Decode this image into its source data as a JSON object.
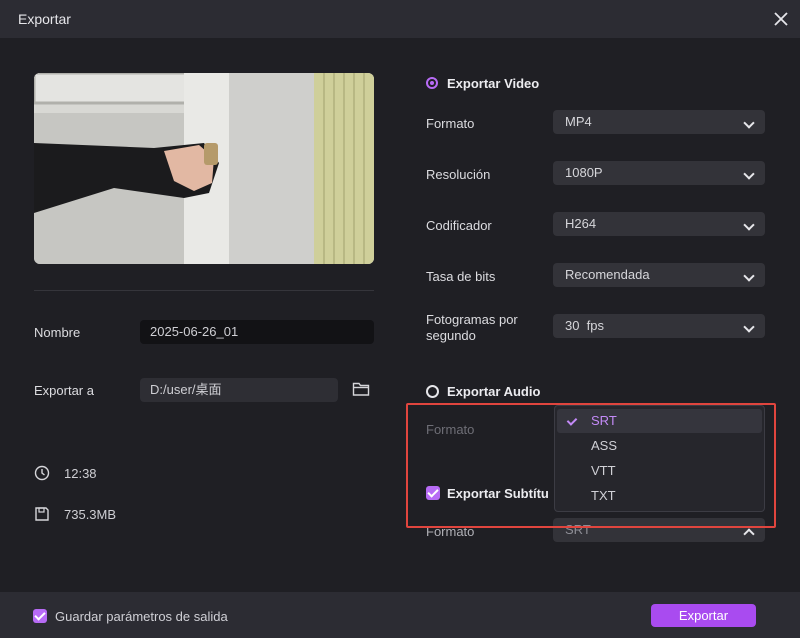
{
  "window": {
    "title": "Exportar"
  },
  "left": {
    "name_label": "Nombre",
    "name_value": "2025-06-26_01",
    "export_label": "Exportar a",
    "export_path": "D:/user/桌面",
    "duration": "12:38",
    "size": "735.3MB"
  },
  "video": {
    "section_label": "Exportar Video",
    "format_label": "Formato",
    "format_value": "MP4",
    "resolution_label": "Resolución",
    "resolution_value": "1080P",
    "codec_label": "Codificador",
    "codec_value": "H264",
    "bitrate_label": "Tasa de bits",
    "bitrate_value": "Recomendada",
    "fps_label_line1": "Fotogramas por",
    "fps_label_line2": "segundo",
    "fps_value": "30  fps"
  },
  "audio": {
    "section_label": "Exportar Audio",
    "format_label": "Formato"
  },
  "subtitles": {
    "section_label": "Exportar Subtítu",
    "format_label": "Formato",
    "format_value": "SRT",
    "options": [
      "SRT",
      "ASS",
      "VTT",
      "TXT"
    ],
    "selected": "SRT"
  },
  "footer": {
    "save_params_label": "Guardar parámetros de salida",
    "export_button": "Exportar"
  },
  "colors": {
    "accent": "#a94bf0",
    "highlight": "#e0453e"
  }
}
